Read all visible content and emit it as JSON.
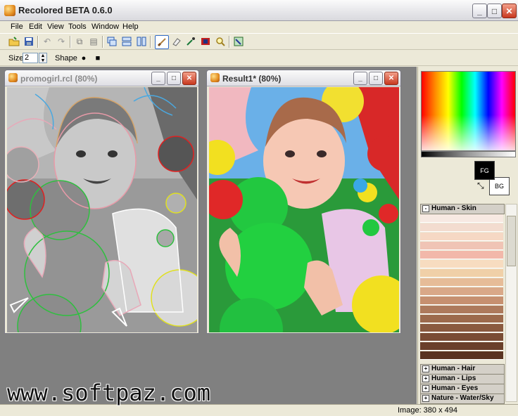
{
  "window": {
    "title": "Recolored BETA 0.6.0",
    "min_label": "_",
    "max_label": "□",
    "close_label": "✕"
  },
  "menu": [
    "File",
    "Edit",
    "View",
    "Tools",
    "Window",
    "Help"
  ],
  "options": {
    "size_label": "Size",
    "size_value": "2",
    "shape_label": "Shape",
    "shape_round": "●",
    "shape_square": "■"
  },
  "documents": [
    {
      "title": "promogirl.rcl (80%)"
    },
    {
      "title": "Result1* (80%)"
    }
  ],
  "panel": {
    "fg_label": "FG",
    "bg_label": "BG",
    "swap_icon": "swap-icon",
    "categories": [
      {
        "expander": "-",
        "label": "Human - Skin"
      },
      {
        "expander": "+",
        "label": "Human - Hair"
      },
      {
        "expander": "+",
        "label": "Human - Lips"
      },
      {
        "expander": "+",
        "label": "Human - Eyes"
      },
      {
        "expander": "+",
        "label": "Nature - Water/Sky"
      }
    ],
    "skin_swatches": [
      "#f7e9e2",
      "#f3dccf",
      "#f6d8c4",
      "#f0c4b5",
      "#f2b8aa",
      "#f7dcc0",
      "#f0d0a8",
      "#e6bc98",
      "#d9a888",
      "#c69070",
      "#ad7a5c",
      "#9c6a4c",
      "#8a5a3f",
      "#7a4c34",
      "#6a3f2a",
      "#5a3322"
    ],
    "accent": "#316ac5"
  },
  "status": {
    "image_info": "Image: 380 x 494"
  },
  "watermark": "www.softpaz.com"
}
